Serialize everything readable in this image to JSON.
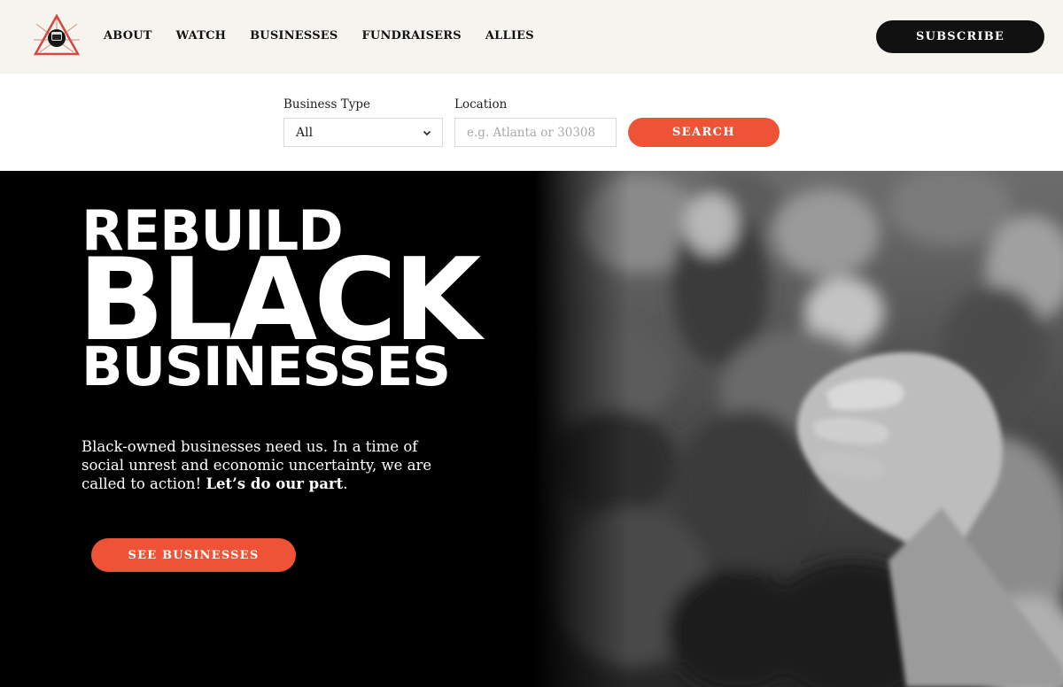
{
  "brand": {
    "logo_icon": "raised-fist-triangle-logo",
    "accent": "#ee5337"
  },
  "nav": {
    "items": [
      {
        "label": "ABOUT"
      },
      {
        "label": "WATCH"
      },
      {
        "label": "BUSINESSES"
      },
      {
        "label": "FUNDRAISERS"
      },
      {
        "label": "ALLIES"
      }
    ],
    "subscribe_label": "SUBSCRIBE"
  },
  "search": {
    "type_label": "Business Type",
    "type_value": "All",
    "location_label": "Location",
    "location_value": "",
    "location_placeholder": "e.g. Atlanta or 30308",
    "button_label": "SEARCH"
  },
  "hero": {
    "line1": "REBUILD",
    "line2": "BLACK",
    "line3": "BUSINESSES",
    "lede_text": "Black-owned businesses need us. In a time of social unrest and economic uncertainty, we are called to action! ",
    "lede_bold": "Let’s do our part",
    "lede_end": ".",
    "cta_label": "SEE BUSINESSES",
    "photo_icon": "raised-fist-crowd-photo"
  }
}
